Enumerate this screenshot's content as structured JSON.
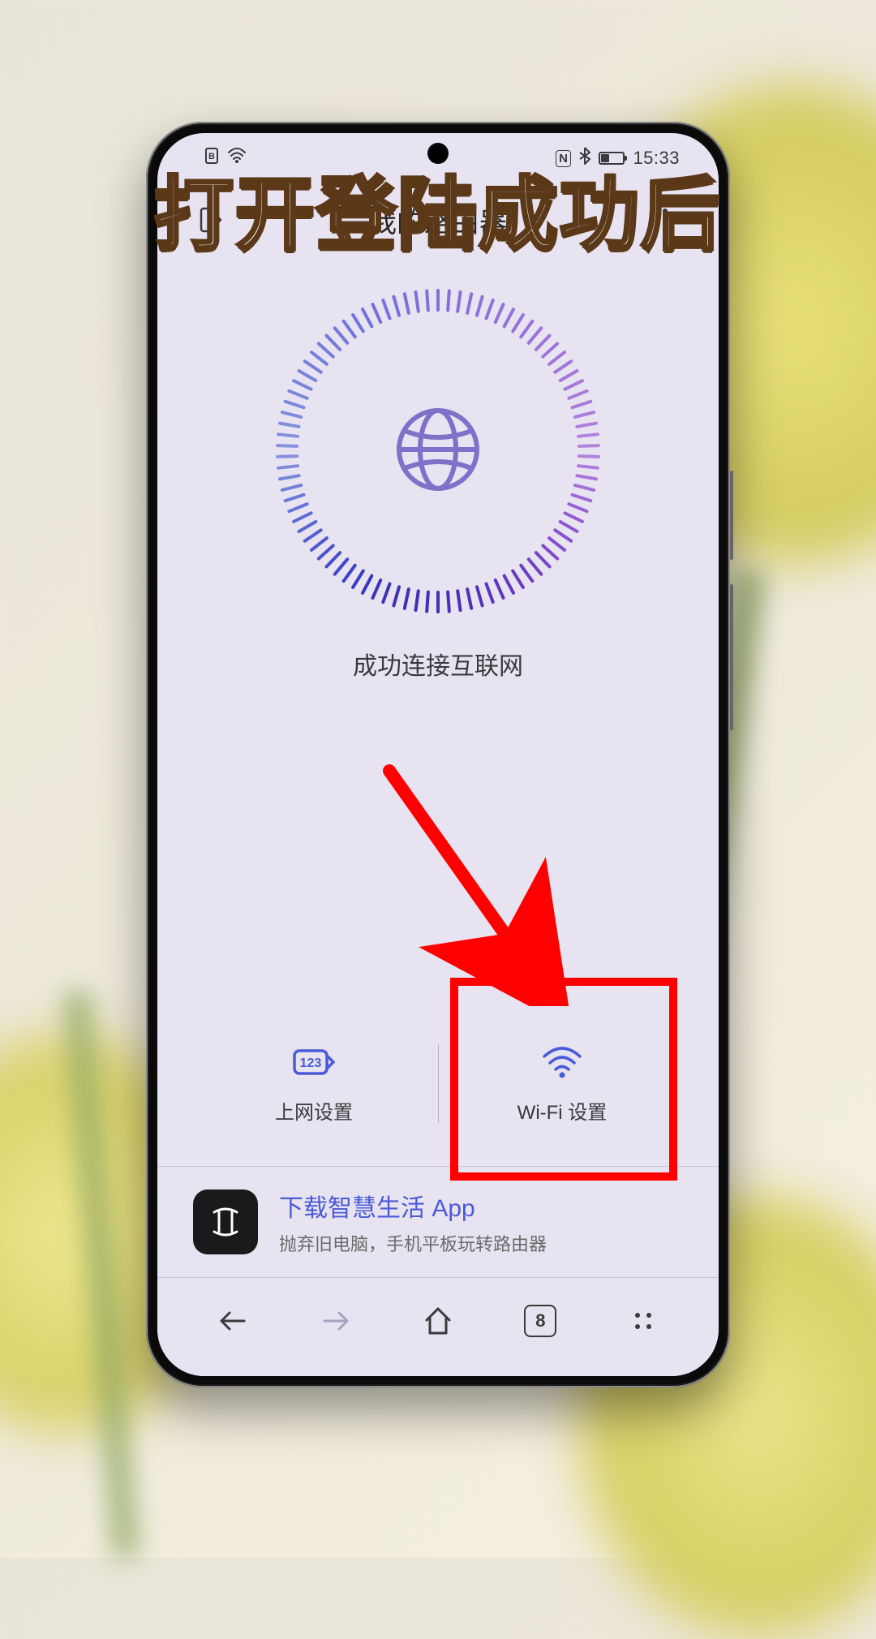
{
  "caption": "打开登陆成功后",
  "status_bar": {
    "time": "15:33",
    "nfc_icon": "N",
    "bluetooth_icon": "✲"
  },
  "header": {
    "title": "我的路由器"
  },
  "connection": {
    "status_text": "成功连接互联网"
  },
  "actions": {
    "internet_settings": "上网设置",
    "wifi_settings": "Wi-Fi 设置",
    "internet_icon_label": "123"
  },
  "promo": {
    "title": "下载智慧生活 App",
    "subtitle": "抛弃旧电脑，手机平板玩转路由器"
  },
  "browser": {
    "tab_count": "8"
  }
}
